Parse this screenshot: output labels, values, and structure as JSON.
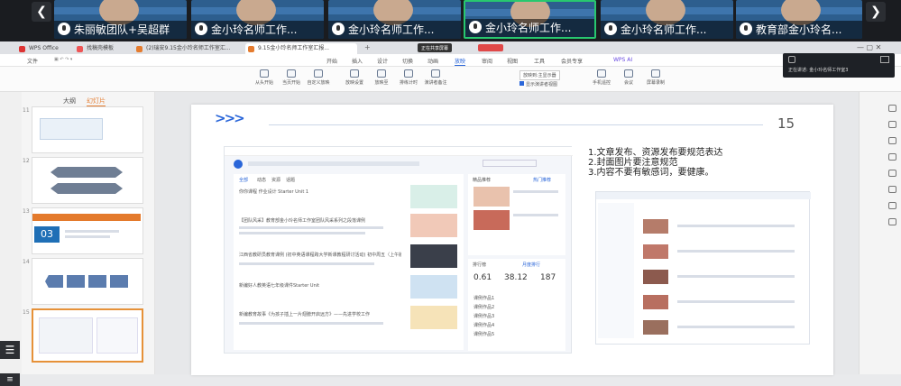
{
  "meeting": {
    "tiles": [
      {
        "name": "朱丽敏团队+吴超群"
      },
      {
        "name": "金小玲名师工作..."
      },
      {
        "name": "金小玲名师工作..."
      },
      {
        "name": "金小玲名师工作..."
      },
      {
        "name": "金小玲名师工作..."
      },
      {
        "name": "金小玲名师工作..."
      },
      {
        "name": "教育部金小玲名..."
      }
    ],
    "prev": "❮",
    "next": "❯"
  },
  "wps": {
    "tabs": [
      {
        "label": "WPS Office"
      },
      {
        "label": "找稿壳模板"
      },
      {
        "label": "(2)瑞安9.15金小玲名师工作室汇..."
      },
      {
        "label": "9.15金小玲名师工作室汇报..."
      }
    ],
    "recording": "正在共享屏幕",
    "menu": [
      "文件",
      "开始",
      "插入",
      "设计",
      "切换",
      "动画",
      "放映",
      "审阅",
      "视图",
      "工具",
      "会员专享",
      "WPS AI"
    ],
    "menu_active": "放映",
    "ribbon": [
      "从头开始",
      "当页开始",
      "自定义放映",
      "放映设置",
      "放映至",
      "排练计时",
      "演讲者备注",
      "手机遥控",
      "会议",
      "屏幕录制"
    ],
    "ribbon_mode": "放映到:主显示器",
    "ribbon_check": "显示演讲者视图",
    "right_panel": "正在讲述: 金小玲名师工作室3",
    "thumbs_header": [
      "大纲",
      "幻灯片"
    ],
    "thumbs": [
      {
        "n": "11"
      },
      {
        "n": "12"
      },
      {
        "n": "13",
        "label": "03"
      },
      {
        "n": "14"
      },
      {
        "n": "15"
      }
    ],
    "slide": {
      "number": "15",
      "arrows": ">>>",
      "notes": [
        "1.文章发布、资源发布要规范表达",
        "2.封面图片要注意规范",
        "3.内容不要有敏感词，要健康。"
      ],
      "web": {
        "tabs": [
          "全部",
          "动态",
          "资源",
          "话题"
        ],
        "articles": [
          "你你课程 作业设计 Starter Unit 1",
          "【团队风采】教育部金小玲名师工作室团队风采系列之段落课例",
          "江西省教研员教育课例 (初中英语课程跨大学新课教程研讨活动) 初中周五（上午版）",
          "新编好人教英语七年级课件Starter Unit",
          "新编教育故事《为孩子插上一片翅膀开启远方》——先进学校工作"
        ],
        "hot_title": "精品推荐",
        "hot_tag": "热门推荐",
        "stats_title": "排行榜",
        "stats_tag": "月度排行",
        "stats": [
          "0.61",
          "38.12",
          "187"
        ],
        "rank": [
          "课例作品1",
          "课例作品2",
          "课例作品3",
          "课例作品4",
          "课例作品5"
        ]
      }
    }
  }
}
